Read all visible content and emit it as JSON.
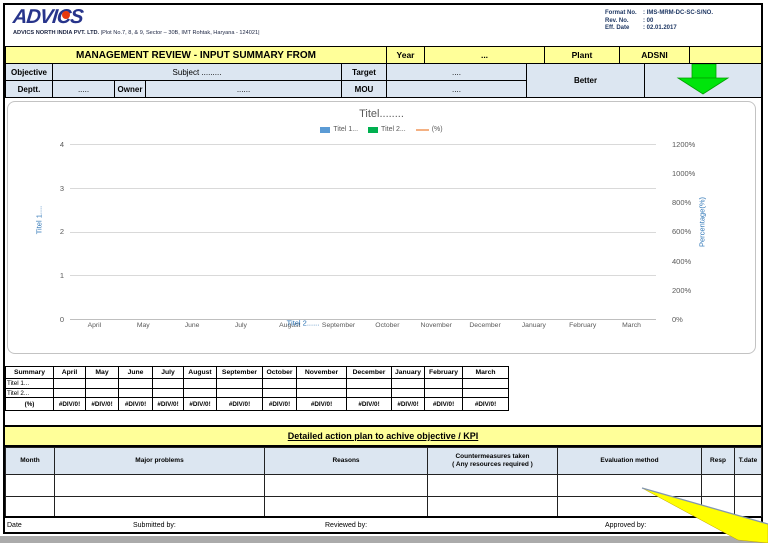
{
  "header": {
    "logo_text": "ADVICS",
    "company_name": "ADVICS NORTH INDIA PVT. LTD.",
    "company_address": " |Plot No.7, 8, & 9, Sector – 30B, IMT Rohtak, Haryana - 124021|",
    "format_rows": [
      {
        "label": "Format No.",
        "value": ": IMS-MRM-DC-SC-S/NO."
      },
      {
        "label": "Rev. No.",
        "value": ": 00"
      },
      {
        "label": "Eff. Date",
        "value": ": 02.01.2017"
      }
    ]
  },
  "title_bar": {
    "title": "MANAGEMENT REVIEW - INPUT SUMMARY FROM",
    "year_label": "Year",
    "year_value": "...",
    "plant_label": "Plant",
    "plant_value": "ADSNI"
  },
  "info": {
    "objective_label": "Objective",
    "subject_value": "Subject .........",
    "target_label": "Target",
    "target_value": "....",
    "deptt_label": "Deptt.",
    "deptt_value": ".....",
    "owner_label": "Owner",
    "owner_value": "......",
    "mou_label": "MOU",
    "mou_value": "....",
    "better_label": "Better"
  },
  "chart_data": {
    "type": "bar",
    "subtype": "combo-bar-line",
    "title": "Titel........",
    "categories": [
      "April",
      "May",
      "June",
      "July",
      "August",
      "September",
      "October",
      "November",
      "December",
      "January",
      "February",
      "March"
    ],
    "series": [
      {
        "name": "Titel 1...",
        "type": "bar",
        "color": "#5B9BD5",
        "values": [
          null,
          null,
          null,
          null,
          null,
          null,
          null,
          null,
          null,
          null,
          null,
          null
        ]
      },
      {
        "name": "Titel 2...",
        "type": "bar",
        "color": "#00B050",
        "values": [
          null,
          null,
          null,
          null,
          null,
          null,
          null,
          null,
          null,
          null,
          null,
          null
        ]
      },
      {
        "name": "(%)",
        "type": "line",
        "color": "#F4B183",
        "values": [
          null,
          null,
          null,
          null,
          null,
          null,
          null,
          null,
          null,
          null,
          null,
          null
        ]
      }
    ],
    "left_axis": {
      "title": "Titel 1....",
      "min": 0,
      "max": 4,
      "ticks": [
        "4",
        "3",
        "2",
        "1",
        "0"
      ]
    },
    "right_axis": {
      "title": "Percentage(%)",
      "min": "0%",
      "max": "1200%",
      "ticks": [
        "1200%",
        "1000%",
        "800%",
        "600%",
        "400%",
        "200%",
        "0%"
      ]
    },
    "x_axis_title": "Titel 2......",
    "grid": true,
    "legend_position": "top",
    "note": "chart plot area is empty - no data series plotted"
  },
  "summary_table": {
    "headers": [
      "Summary",
      "April",
      "May",
      "June",
      "July",
      "August",
      "September",
      "October",
      "November",
      "December",
      "January",
      "February",
      "March"
    ],
    "rows": [
      {
        "label": "Titel 1...",
        "values": [
          "",
          "",
          "",
          "",
          "",
          "",
          "",
          "",
          "",
          "",
          "",
          ""
        ]
      },
      {
        "label": "Titel 2...",
        "values": [
          "",
          "",
          "",
          "",
          "",
          "",
          "",
          "",
          "",
          "",
          "",
          ""
        ]
      },
      {
        "label": "(%)",
        "values": [
          "#DIV/0!",
          "#DIV/0!",
          "#DIV/0!",
          "#DIV/0!",
          "#DIV/0!",
          "#DIV/0!",
          "#DIV/0!",
          "#DIV/0!",
          "#DIV/0!",
          "#DIV/0!",
          "#DIV/0!",
          "#DIV/0!"
        ]
      }
    ]
  },
  "action_plan": {
    "title": "Detailed action plan to achive objective / KPI",
    "columns": [
      {
        "label": "Month"
      },
      {
        "label": "Major problems"
      },
      {
        "label": "Reasons"
      },
      {
        "label": "Countermeasures taken",
        "sub": "( Any resources required )"
      },
      {
        "label": "Evaluation method"
      },
      {
        "label": "Resp"
      },
      {
        "label": "T.date"
      }
    ],
    "rows": [
      [
        "",
        "",
        "",
        "",
        "",
        "",
        ""
      ],
      [
        "",
        "",
        "",
        "",
        "",
        "",
        ""
      ]
    ]
  },
  "footer": {
    "date_label": "Date",
    "submitted_label": "Submitted by:",
    "reviewed_label": "Reviewed by:",
    "approved_label": "Approved by:"
  },
  "colors": {
    "band_yellow": "#FFFF99",
    "band_blue": "#DCE6F1",
    "green_arrow": "#00E50B",
    "logo_navy": "#27348B",
    "logo_red": "#E8380D"
  }
}
